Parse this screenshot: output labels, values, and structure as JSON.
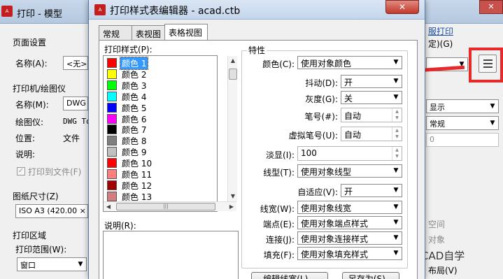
{
  "background_dialog": {
    "title": "打印 - 模型",
    "close_label": "✕",
    "page_setup_label": "页面设置",
    "name_label": "名称(A):",
    "name_value": "<无>",
    "printer_section_label": "打印机/绘图仪",
    "printer_name_label": "名称(M):",
    "printer_name_value": "DWG",
    "plotter_label": "绘图仪:",
    "plotter_value": "DWG To",
    "location_label": "位置:",
    "location_value": "文件",
    "description_label": "说明:",
    "print_to_file_label": "打印到文件(F)",
    "paper_size_label": "图纸尺寸(Z)",
    "paper_size_value": "ISO A3 (420.00 ×",
    "plot_area_label": "打印区域",
    "plot_range_label": "打印范围(W):",
    "plot_range_value": "窗口",
    "right_link": "服打印",
    "right_top_text": "定)(G)",
    "right_combo_1": "显示",
    "right_combo_2": "常规",
    "right_value_3": "0",
    "right_text_4": "空间",
    "right_text_5": "对象",
    "right_text_6": "布局(V)"
  },
  "watermark": "天正CAD自学",
  "editor": {
    "title": "打印样式表编辑器 - acad.ctb",
    "close_label": "✕",
    "tabs": [
      {
        "label": "常规"
      },
      {
        "label": "表视图"
      },
      {
        "label": "表格视图"
      }
    ],
    "active_tab": 2,
    "styles_label": "打印样式(P):",
    "description_label": "说明(R):",
    "styles": [
      {
        "label": "颜色 1",
        "color": "#ff0000",
        "selected": true
      },
      {
        "label": "颜色 2",
        "color": "#ffff00"
      },
      {
        "label": "颜色 3",
        "color": "#00ff00"
      },
      {
        "label": "颜色 4",
        "color": "#00ffff"
      },
      {
        "label": "颜色 5",
        "color": "#0000ff"
      },
      {
        "label": "颜色 6",
        "color": "#ff00ff"
      },
      {
        "label": "颜色 7",
        "color": "#000000"
      },
      {
        "label": "颜色 8",
        "color": "#808080"
      },
      {
        "label": "颜色 9",
        "color": "#c0c0c0"
      },
      {
        "label": "颜色 10",
        "color": "#ff0000"
      },
      {
        "label": "颜色 11",
        "color": "#ff7f7f"
      },
      {
        "label": "颜色 12",
        "color": "#a50000"
      },
      {
        "label": "颜色 13",
        "color": "#d47f7f"
      }
    ],
    "properties": {
      "group_title": "特性",
      "color_label": "颜色(C):",
      "color_value": "使用对象颜色",
      "dither_label": "抖动(D):",
      "dither_value": "开",
      "grayscale_label": "灰度(G):",
      "grayscale_value": "关",
      "pen_label": "笔号(#):",
      "pen_value": "自动",
      "virtual_pen_label": "虚拟笔号(U):",
      "virtual_pen_value": "自动",
      "screening_label": "淡显(I):",
      "screening_value": "100",
      "linetype_label": "线型(T):",
      "linetype_value": "使用对象线型",
      "adaptive_label": "自适应(V):",
      "adaptive_value": "开",
      "lineweight_label": "线宽(W):",
      "lineweight_value": "使用对象线宽",
      "endstyle_label": "端点(E):",
      "endstyle_value": "使用对象端点样式",
      "joinstyle_label": "连接(J):",
      "joinstyle_value": "使用对象连接样式",
      "fillstyle_label": "填充(F):",
      "fillstyle_value": "使用对象填充样式",
      "edit_lineweights_label": "编辑线宽(L)...",
      "save_as_label": "另存为(S)..."
    }
  },
  "colors": {
    "annotation_red": "#e8292a",
    "selection_blue": "#3399ff"
  }
}
